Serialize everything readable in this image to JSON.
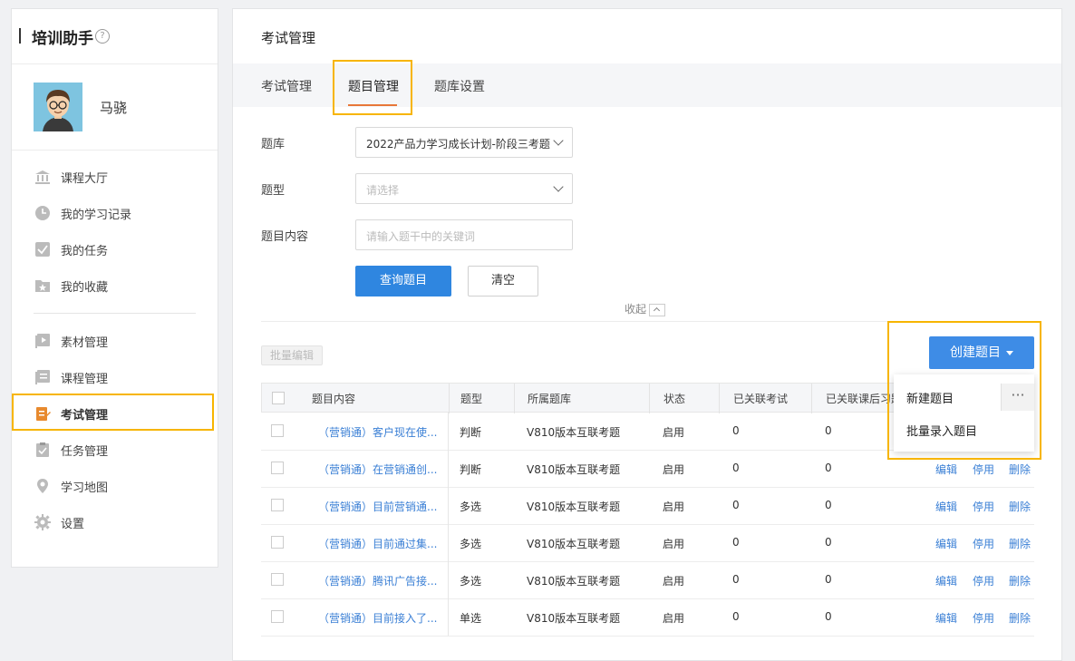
{
  "app": {
    "title": "培训助手",
    "help_icon": "?"
  },
  "user": {
    "name": "马骁"
  },
  "nav": {
    "group1": [
      {
        "label": "课程大厅",
        "icon": "bank-icon"
      },
      {
        "label": "我的学习记录",
        "icon": "clock-icon"
      },
      {
        "label": "我的任务",
        "icon": "checkbox-icon"
      },
      {
        "label": "我的收藏",
        "icon": "star-folder-icon"
      }
    ],
    "group2": [
      {
        "label": "素材管理",
        "icon": "play-icon"
      },
      {
        "label": "课程管理",
        "icon": "course-icon"
      },
      {
        "label": "考试管理",
        "icon": "exam-icon",
        "active": true
      },
      {
        "label": "任务管理",
        "icon": "clipboard-icon"
      },
      {
        "label": "学习地图",
        "icon": "pin-icon"
      },
      {
        "label": "设置",
        "icon": "gear-icon"
      }
    ]
  },
  "page": {
    "title": "考试管理",
    "tabs": [
      {
        "label": "考试管理"
      },
      {
        "label": "题目管理",
        "active": true
      },
      {
        "label": "题库设置"
      }
    ]
  },
  "filters": {
    "bank_label": "题库",
    "bank_value": "2022产品力学习成长计划-阶段三考题",
    "type_label": "题型",
    "type_placeholder": "请选择",
    "content_label": "题目内容",
    "content_placeholder": "请输入题干中的关键词",
    "query_button": "查询题目",
    "clear_button": "清空",
    "collapse_label": "收起"
  },
  "toolbar": {
    "batch_edit": "批量编辑",
    "create_button": "创建题目",
    "dropdown": [
      "新建题目",
      "批量录入题目"
    ],
    "more": "···"
  },
  "table": {
    "headers": [
      "题目内容",
      "题型",
      "所属题库",
      "状态",
      "已关联考试",
      "已关联课后习题"
    ],
    "rows": [
      {
        "content": "（营销通）客户现在使...",
        "type": "判断",
        "bank": "V810版本互联考题",
        "status": "启用",
        "exams": "0",
        "exercises": "0"
      },
      {
        "content": "（营销通）在营销通创...",
        "type": "判断",
        "bank": "V810版本互联考题",
        "status": "启用",
        "exams": "0",
        "exercises": "0"
      },
      {
        "content": "（营销通）目前营销通...",
        "type": "多选",
        "bank": "V810版本互联考题",
        "status": "启用",
        "exams": "0",
        "exercises": "0"
      },
      {
        "content": "（营销通）目前通过集...",
        "type": "多选",
        "bank": "V810版本互联考题",
        "status": "启用",
        "exams": "0",
        "exercises": "0"
      },
      {
        "content": "（营销通）腾讯广告接...",
        "type": "多选",
        "bank": "V810版本互联考题",
        "status": "启用",
        "exams": "0",
        "exercises": "0"
      },
      {
        "content": "（营销通）目前接入了...",
        "type": "单选",
        "bank": "V810版本互联考题",
        "status": "启用",
        "exams": "0",
        "exercises": "0"
      }
    ],
    "actions": [
      "编辑",
      "停用",
      "删除"
    ]
  },
  "colors": {
    "accent": "#2f86e0",
    "highlight": "#f7b500",
    "tab_underline": "#e87738"
  }
}
